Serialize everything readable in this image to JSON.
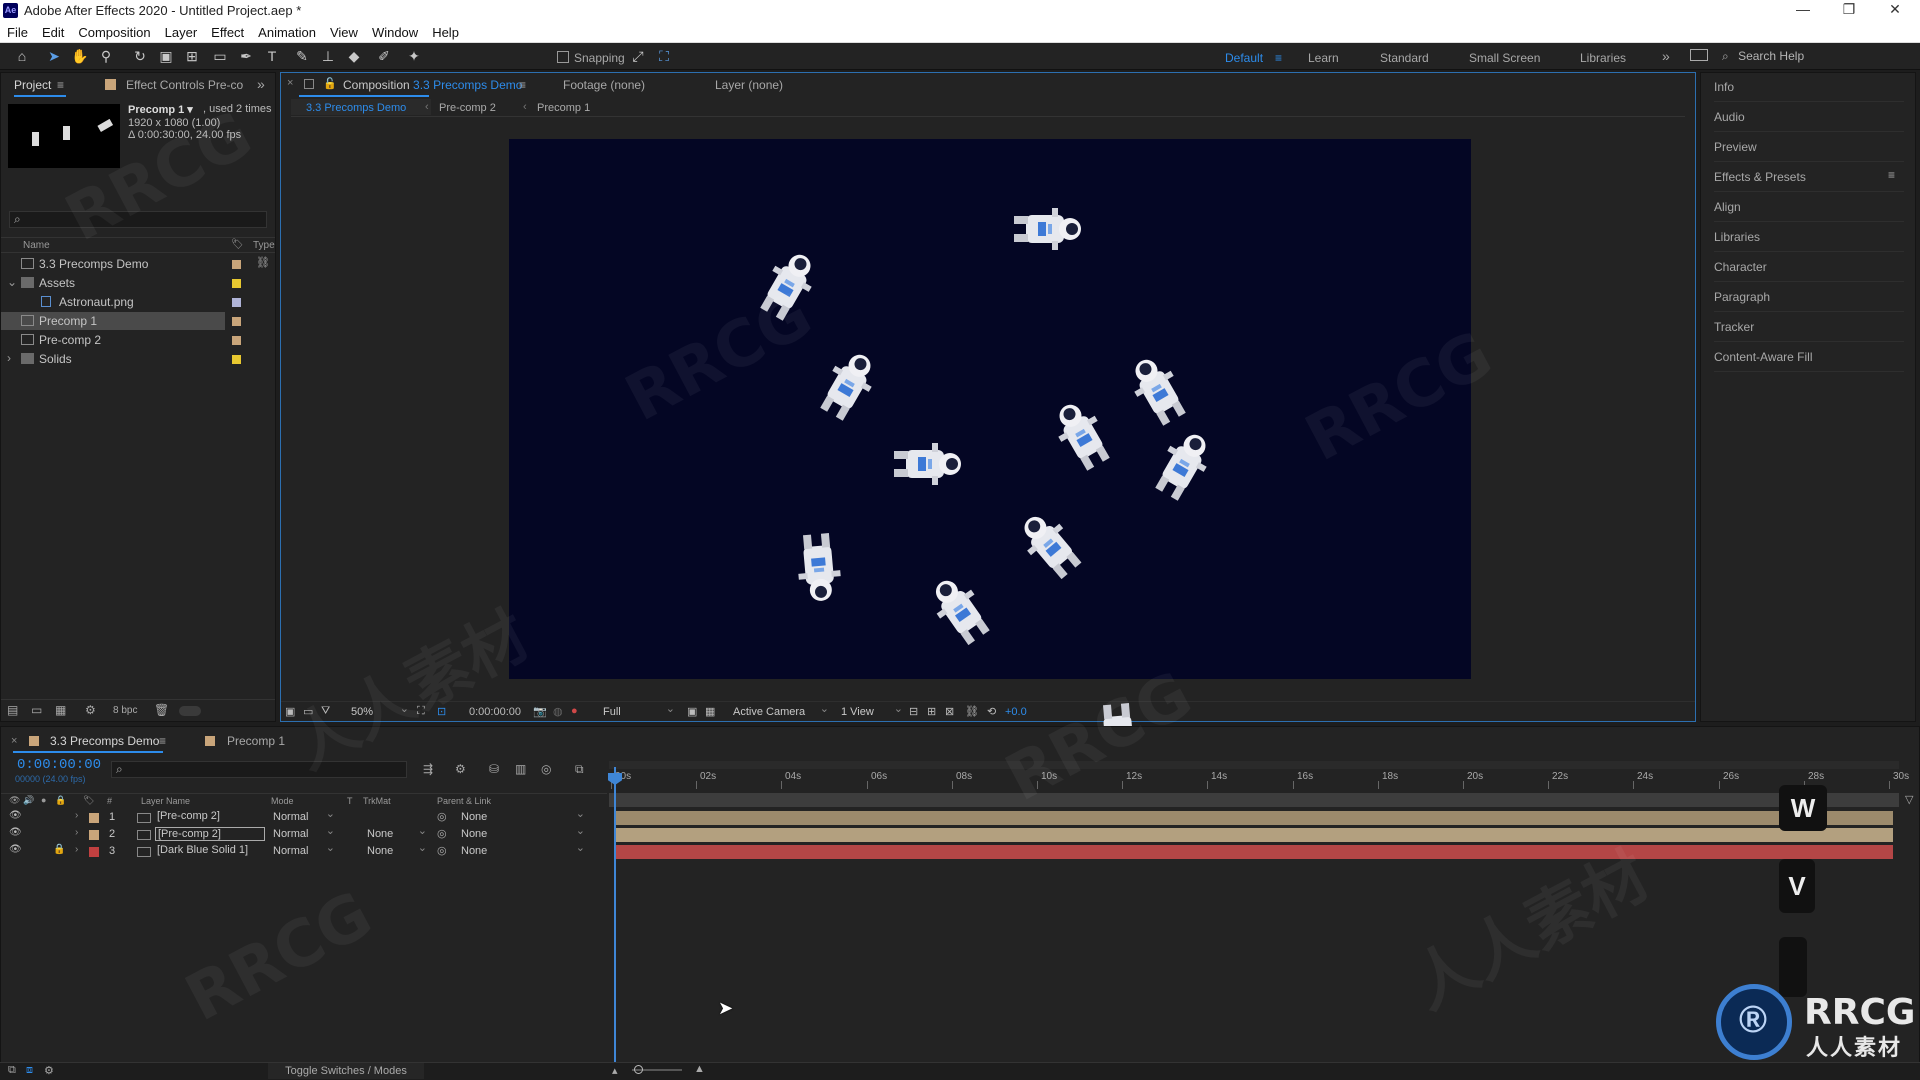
{
  "window": {
    "title": "Adobe After Effects 2020 - Untitled Project.aep *",
    "logo_text": "Ae",
    "controls": [
      "—",
      "❐",
      "✕"
    ]
  },
  "menu": [
    "File",
    "Edit",
    "Composition",
    "Layer",
    "Effect",
    "Animation",
    "View",
    "Window",
    "Help"
  ],
  "toolbar": {
    "snapping_label": "Snapping",
    "workspaces": [
      "Default",
      "Learn",
      "Standard",
      "Small Screen",
      "Libraries"
    ],
    "active_workspace": "Default",
    "more": "»",
    "search_placeholder": "Search Help"
  },
  "project_panel": {
    "tab_project": "Project",
    "tab_effect_controls": "Effect Controls Pre-co",
    "preview_name": "Precomp 1 ▾",
    "preview_used": ", used 2 times",
    "preview_size": "1920 x 1080 (1.00)",
    "preview_duration": "Δ 0:00:30:00, 24.00 fps",
    "search_icon": "⌕",
    "col_name": "Name",
    "col_type": "Type",
    "items": [
      {
        "name": "3.3 Precomps Demo",
        "indent": 0,
        "kind": "comp",
        "color": "#c9a57a",
        "selected": false,
        "arrow": ""
      },
      {
        "name": "Assets",
        "indent": 0,
        "kind": "folder",
        "color": "#e8c830",
        "selected": false,
        "arrow": "⌄"
      },
      {
        "name": "Astronaut.png",
        "indent": 1,
        "kind": "file",
        "color": "#b0b4d8",
        "selected": false,
        "arrow": ""
      },
      {
        "name": "Precomp 1",
        "indent": 0,
        "kind": "comp",
        "color": "#c9a57a",
        "selected": true,
        "arrow": ""
      },
      {
        "name": "Pre-comp 2",
        "indent": 0,
        "kind": "comp",
        "color": "#c9a57a",
        "selected": false,
        "arrow": ""
      },
      {
        "name": "Solids",
        "indent": 0,
        "kind": "folder",
        "color": "#e8c830",
        "selected": false,
        "arrow": "›"
      }
    ],
    "bpc": "8 bpc"
  },
  "viewer": {
    "tab_composition_prefix": "Composition",
    "tab_composition_name": "3.3 Precomps Demo",
    "tab_footage": "Footage (none)",
    "tab_layer": "Layer (none)",
    "breadcrumbs": [
      "3.3 Precomps Demo",
      "Pre-comp 2",
      "Precomp 1"
    ],
    "zoom": "50%",
    "timecode": "0:00:00:00",
    "resolution": "Full",
    "camera": "Active Camera",
    "views": "1 View",
    "exposure": "+0.0",
    "canvas_color": "#040624"
  },
  "right_panel": {
    "items": [
      "Info",
      "Audio",
      "Preview",
      "Effects & Presets",
      "Align",
      "Libraries",
      "Character",
      "Paragraph",
      "Tracker",
      "Content-Aware Fill"
    ]
  },
  "timeline": {
    "tab_active": "3.3 Precomps Demo",
    "tab_other": "Precomp 1",
    "current_time": "0:00:00:00",
    "frame_info": "00000 (24.00 fps)",
    "col_layer_name": "Layer Name",
    "col_mode": "Mode",
    "col_t": "T",
    "col_trkmat": "TrkMat",
    "col_parent": "Parent & Link",
    "ruler": [
      "00s",
      "02s",
      "04s",
      "06s",
      "08s",
      "10s",
      "12s",
      "14s",
      "16s",
      "18s",
      "20s",
      "22s",
      "24s",
      "26s",
      "28s",
      "30s"
    ],
    "layers": [
      {
        "num": "1",
        "name": "[Pre-comp 2]",
        "mode": "Normal",
        "trkmat": "",
        "parent": "None",
        "color": "#c9a57a",
        "locked": false,
        "selected": false,
        "bar": "#9c8a6c"
      },
      {
        "num": "2",
        "name": "[Pre-comp 2]",
        "mode": "Normal",
        "trkmat": "None",
        "parent": "None",
        "color": "#c9a57a",
        "locked": false,
        "selected": true,
        "bar": "#b3a07f"
      },
      {
        "num": "3",
        "name": "[Dark Blue Solid 1]",
        "mode": "Normal",
        "trkmat": "None",
        "parent": "None",
        "color": "#c14040",
        "locked": true,
        "selected": false,
        "bar": "#b44646"
      }
    ],
    "toggle_label": "Toggle Switches / Modes",
    "key_overlays": [
      "W",
      "V"
    ]
  },
  "watermark": {
    "rrcg": "RRCG",
    "cn": "人人素材"
  }
}
